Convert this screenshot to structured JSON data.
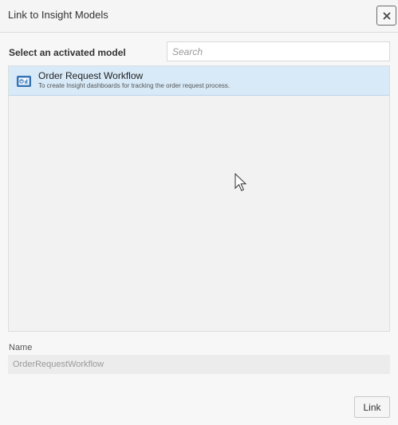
{
  "dialog": {
    "title": "Link to Insight Models",
    "close_icon": "close-icon"
  },
  "models": {
    "label": "Select an activated model",
    "search_placeholder": "Search",
    "items": [
      {
        "icon": "dashboard-icon",
        "name": "Order Request Workflow",
        "description": "To create Insight dashboards for tracking the order request process.",
        "selected": true
      }
    ]
  },
  "name_field": {
    "label": "Name",
    "value": "OrderRequestWorkflow"
  },
  "actions": {
    "link_label": "Link"
  },
  "colors": {
    "selected_row": "#d8eaf8",
    "icon_blue": "#3f7fc2"
  }
}
